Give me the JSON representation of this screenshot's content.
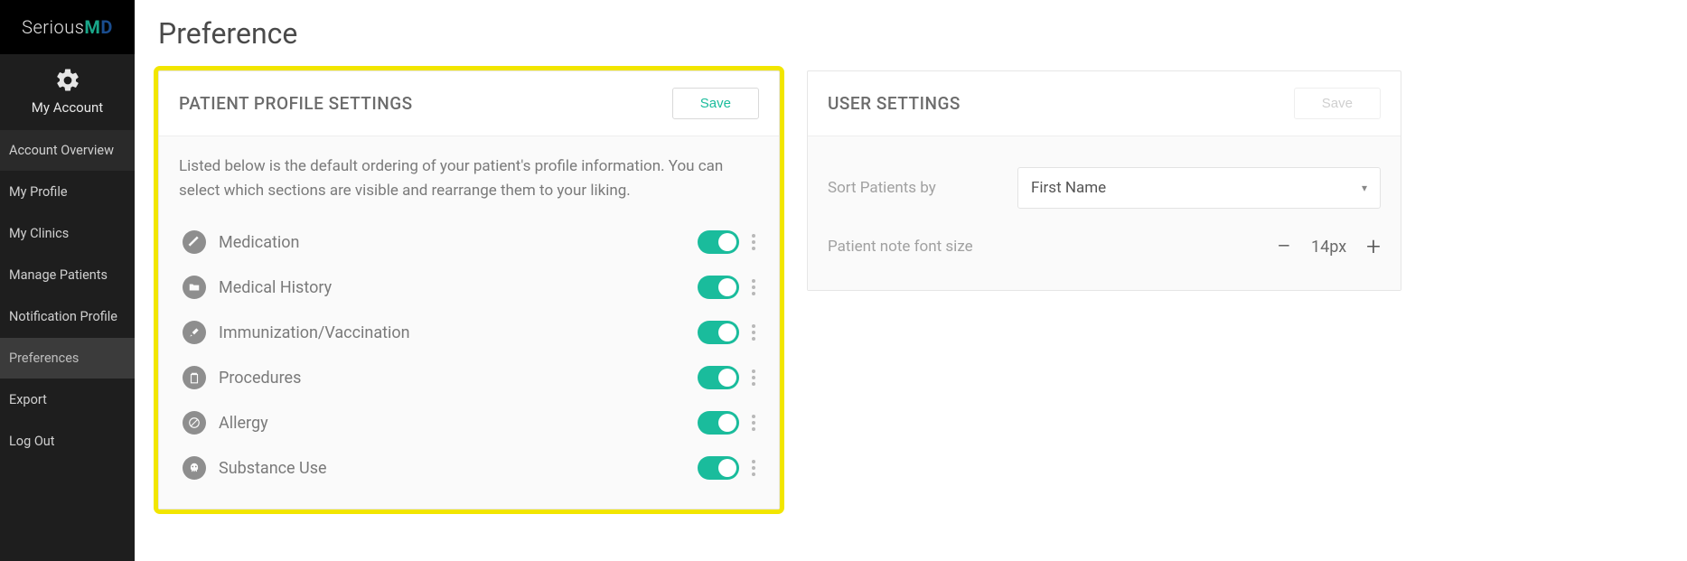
{
  "brand": {
    "part1": "Serious",
    "part2": "M",
    "part3": "D"
  },
  "sidebar": {
    "my_account": "My Account",
    "items": [
      {
        "label": "Account Overview"
      },
      {
        "label": "My Profile"
      },
      {
        "label": "My Clinics"
      },
      {
        "label": "Manage Patients"
      },
      {
        "label": "Notification Profile"
      },
      {
        "label": "Preferences"
      },
      {
        "label": "Export"
      },
      {
        "label": "Log Out"
      }
    ]
  },
  "page": {
    "title": "Preference"
  },
  "profile_card": {
    "title": "PATIENT PROFILE SETTINGS",
    "save_label": "Save",
    "description": "Listed below is the default ordering of your patient's profile information. You can select which sections are visible and rearrange them to your liking.",
    "items": [
      {
        "label": "Medication",
        "icon": "pill-icon",
        "enabled": true
      },
      {
        "label": "Medical History",
        "icon": "folder-icon",
        "enabled": true
      },
      {
        "label": "Immunization/Vaccination",
        "icon": "syringe-icon",
        "enabled": true
      },
      {
        "label": "Procedures",
        "icon": "clipboard-icon",
        "enabled": true
      },
      {
        "label": "Allergy",
        "icon": "prohibit-icon",
        "enabled": true
      },
      {
        "label": "Substance Use",
        "icon": "skull-icon",
        "enabled": true
      }
    ]
  },
  "user_card": {
    "title": "USER SETTINGS",
    "save_label": "Save",
    "sort_label": "Sort Patients by",
    "sort_value": "First Name",
    "font_label": "Patient note font size",
    "font_value": "14px"
  }
}
